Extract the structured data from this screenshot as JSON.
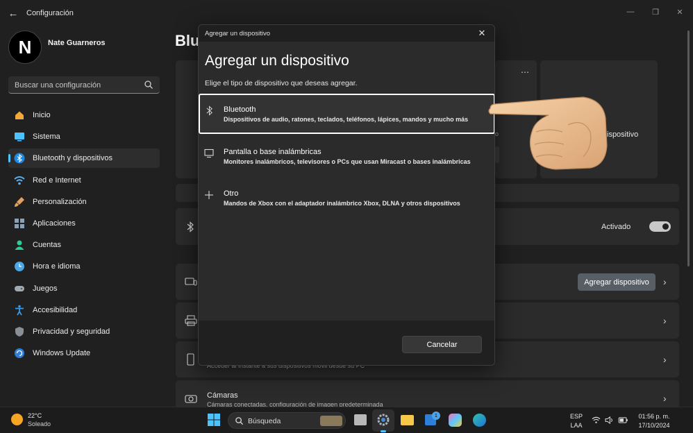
{
  "window": {
    "app_title": "Configuración",
    "back_icon": "back-arrow-icon",
    "controls": [
      "minimize-icon",
      "maximize-icon",
      "close-icon"
    ]
  },
  "profile": {
    "name": "Nate Guarneros",
    "avatar_letter": "N"
  },
  "search": {
    "placeholder": "Buscar una configuración"
  },
  "sidebar": {
    "items": [
      {
        "label": "Inicio",
        "icon": "home-icon",
        "color": "#f2a83c"
      },
      {
        "label": "Sistema",
        "icon": "monitor-icon",
        "color": "#4cc2ff"
      },
      {
        "label": "Bluetooth y dispositivos",
        "icon": "bluetooth-icon",
        "color": "#1e88e5",
        "active": true
      },
      {
        "label": "Red e Internet",
        "icon": "wifi-icon",
        "color": "#5ab0f0"
      },
      {
        "label": "Personalización",
        "icon": "brush-icon",
        "color": "#e0a060"
      },
      {
        "label": "Aplicaciones",
        "icon": "apps-icon",
        "color": "#8aa0b8"
      },
      {
        "label": "Cuentas",
        "icon": "person-icon",
        "color": "#2ecc9a"
      },
      {
        "label": "Hora e idioma",
        "icon": "globe-clock-icon",
        "color": "#4aa8e8"
      },
      {
        "label": "Juegos",
        "icon": "gamepad-icon",
        "color": "#a0a8b0"
      },
      {
        "label": "Accesibilidad",
        "icon": "accessibility-icon",
        "color": "#3a9be8"
      },
      {
        "label": "Privacidad y seguridad",
        "icon": "shield-icon",
        "color": "#8a8f96"
      },
      {
        "label": "Windows Update",
        "icon": "update-icon",
        "color": "#2f7fd8"
      }
    ]
  },
  "main": {
    "page_title_visible": "Blu",
    "card_label_right": "ispositivo",
    "bluetooth_status": "Activado",
    "add_device_button": "Agregar dispositivo",
    "phone_desc_partial": "Acceder al instante a sus dispositivos móvil desde su PC",
    "cameras_title": "Cámaras",
    "cameras_desc": "Cámaras conectadas, configuración de imagen predeterminada"
  },
  "dialog": {
    "titlebar": "Agregar un dispositivo",
    "heading": "Agregar un dispositivo",
    "subtitle": "Elige el tipo de dispositivo que deseas agregar.",
    "options": [
      {
        "title": "Bluetooth",
        "desc": "Dispositivos de audio, ratones, teclados, teléfonos, lápices, mandos y mucho más",
        "icon": "bluetooth-icon",
        "selected": true
      },
      {
        "title": "Pantalla o base inalámbricas",
        "desc": "Monitores inalámbricos, televisores o PCs que usan Miracast o bases inalámbricas",
        "icon": "monitor-icon"
      },
      {
        "title": "Otro",
        "desc": "Mandos de Xbox con el adaptador inalámbrico Xbox, DLNA y otros dispositivos",
        "icon": "plus-icon"
      }
    ],
    "cancel": "Cancelar"
  },
  "taskbar": {
    "weather": {
      "temp": "22°C",
      "condition": "Soleado"
    },
    "search_label": "Búsqueda",
    "mail_badge": "1",
    "lang_top": "ESP",
    "lang_bottom": "LAA",
    "time": "01:56 p. m.",
    "date": "17/10/2024"
  }
}
